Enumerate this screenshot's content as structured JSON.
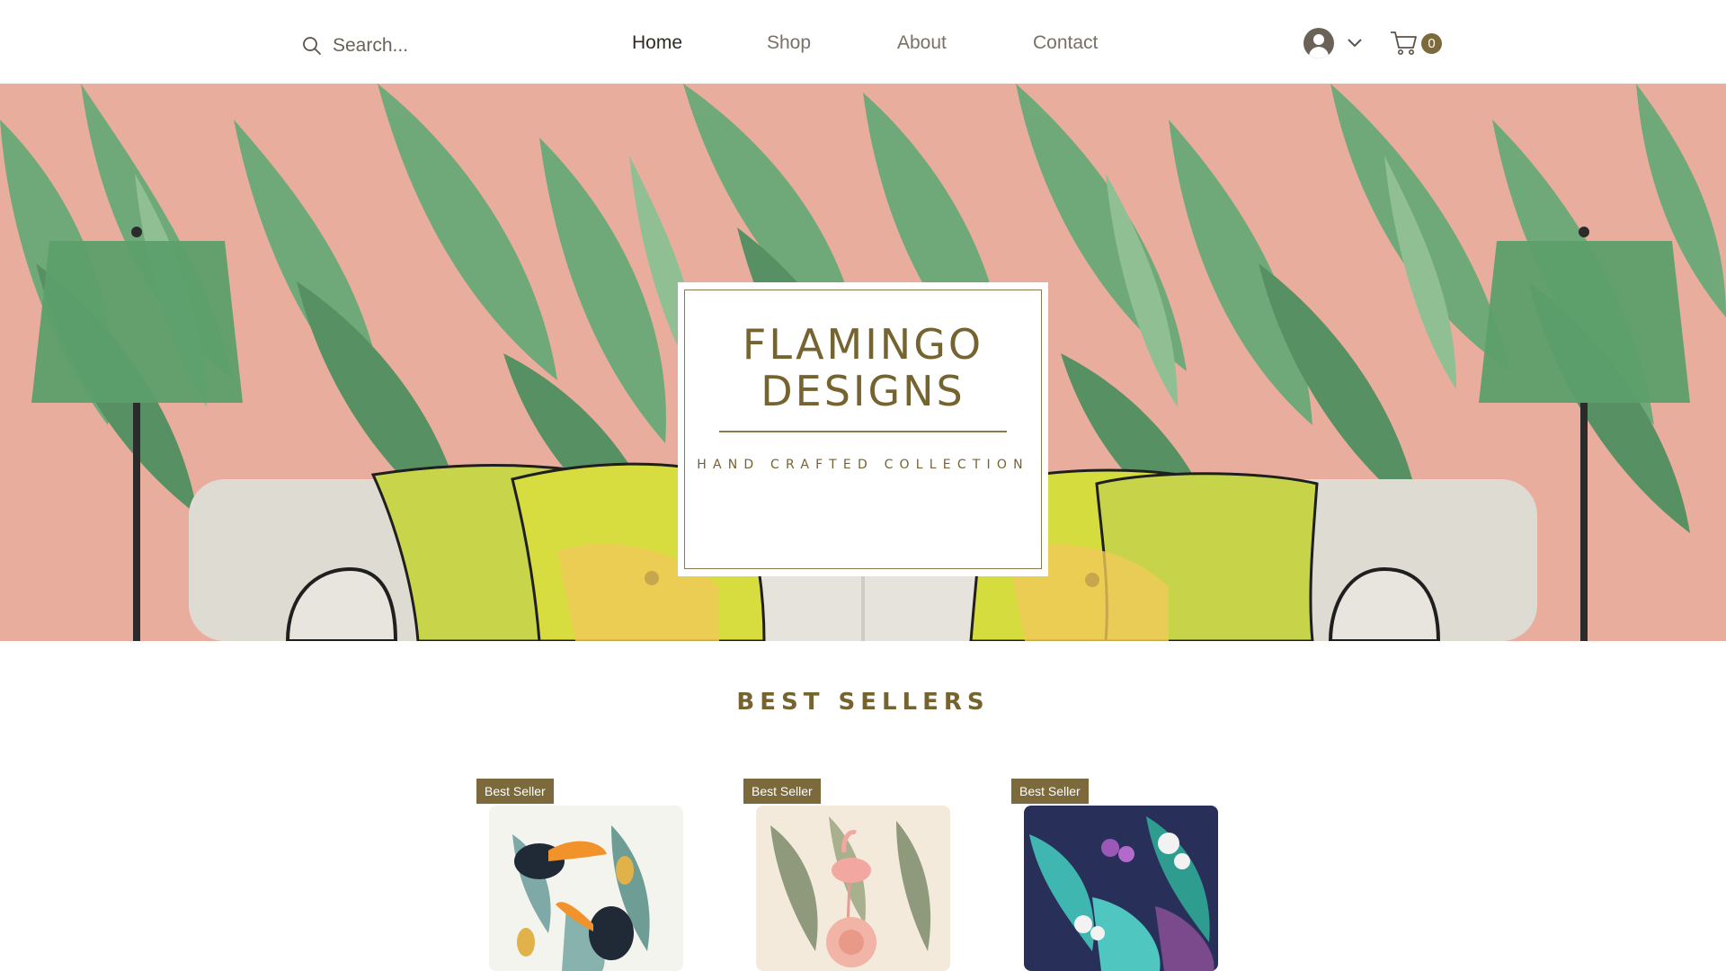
{
  "header": {
    "search_placeholder": "Search...",
    "nav": [
      {
        "label": "Home",
        "active": true
      },
      {
        "label": "Shop"
      },
      {
        "label": "About"
      },
      {
        "label": "Contact"
      }
    ],
    "cart_count": "0"
  },
  "hero": {
    "brand_line1": "FLAMINGO",
    "brand_line2": "DESIGNS",
    "tagline": "HAND CRAFTED COLLECTION"
  },
  "best_sellers": {
    "title": "BEST SELLERS",
    "products": [
      {
        "badge": "Best Seller",
        "pattern": "toucan-pineapple"
      },
      {
        "badge": "Best Seller",
        "pattern": "flamingo-palm"
      },
      {
        "badge": "Best Seller",
        "pattern": "orchid-leaves"
      }
    ]
  },
  "colors": {
    "accent": "#7d6a3c",
    "hero_pink": "#eab0a0",
    "leaf_green": "#5f9e6b"
  }
}
